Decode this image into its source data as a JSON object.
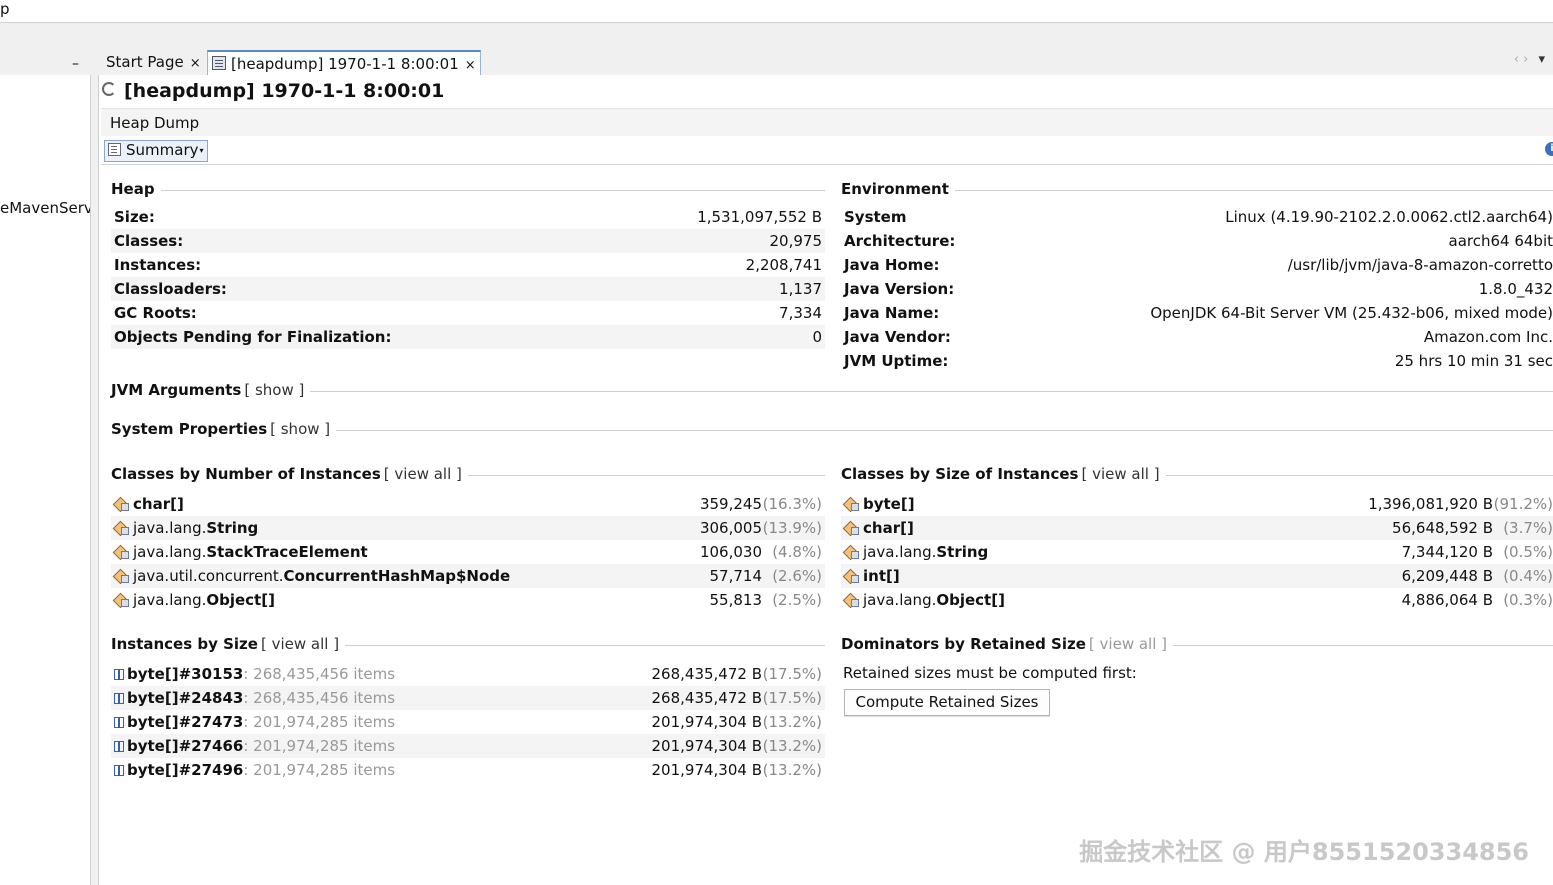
{
  "window": {
    "menu_fragment": "p"
  },
  "left_panel": {
    "text": "eMavenServ",
    "minimize": "–"
  },
  "tabs": [
    {
      "label": "Start Page",
      "close": "×"
    },
    {
      "label": "[heapdump] 1970-1-1 8:00:01",
      "close": "×"
    }
  ],
  "tab_nav": {
    "prev": "‹",
    "next": "›",
    "menu": "▾"
  },
  "doc": {
    "title": "[heapdump] 1970-1-1 8:00:01",
    "subtitle": "Heap Dump",
    "view_select": "Summary",
    "info": "i"
  },
  "heap": {
    "title": "Heap",
    "rows": [
      {
        "key": "Size:",
        "value": "1,531,097,552 B"
      },
      {
        "key": "Classes:",
        "value": "20,975"
      },
      {
        "key": "Instances:",
        "value": "2,208,741"
      },
      {
        "key": "Classloaders:",
        "value": "1,137"
      },
      {
        "key": "GC Roots:",
        "value": "7,334"
      },
      {
        "key": "Objects Pending for Finalization:",
        "value": "0"
      }
    ]
  },
  "environment": {
    "title": "Environment",
    "rows": [
      {
        "key": "System",
        "value": "Linux (4.19.90-2102.2.0.0062.ctl2.aarch64)"
      },
      {
        "key": "Architecture:",
        "value": "aarch64 64bit"
      },
      {
        "key": "Java Home:",
        "value": "/usr/lib/jvm/java-8-amazon-corretto"
      },
      {
        "key": "Java Version:",
        "value": "1.8.0_432"
      },
      {
        "key": "Java Name:",
        "value": "OpenJDK 64-Bit Server VM (25.432-b06, mixed mode)"
      },
      {
        "key": "Java Vendor:",
        "value": "Amazon.com Inc."
      },
      {
        "key": "JVM Uptime:",
        "value": "25 hrs 10 min 31 sec"
      }
    ]
  },
  "jvm_args": {
    "title": "JVM Arguments",
    "link": "[ show ]"
  },
  "sys_props": {
    "title": "System Properties",
    "link": "[ show ]"
  },
  "by_number": {
    "title": "Classes by Number of Instances",
    "link": "[ view all ]",
    "rows": [
      {
        "pkg": "",
        "name": "char[]",
        "count": "359,245",
        "pct": "(16.3%)"
      },
      {
        "pkg": "java.lang.",
        "name": "String",
        "count": "306,005",
        "pct": "(13.9%)"
      },
      {
        "pkg": "java.lang.",
        "name": "StackTraceElement",
        "count": "106,030",
        "pct": "(4.8%)"
      },
      {
        "pkg": "java.util.concurrent.",
        "name": "ConcurrentHashMap$Node",
        "count": "57,714",
        "pct": "(2.6%)"
      },
      {
        "pkg": "java.lang.",
        "name": "Object[]",
        "count": "55,813",
        "pct": "(2.5%)"
      }
    ]
  },
  "by_size": {
    "title": "Classes by Size of Instances",
    "link": "[ view all ]",
    "rows": [
      {
        "pkg": "",
        "name": "byte[]",
        "size": "1,396,081,920 B",
        "pct": "(91.2%)"
      },
      {
        "pkg": "",
        "name": "char[]",
        "size": "56,648,592 B",
        "pct": "(3.7%)"
      },
      {
        "pkg": "java.lang.",
        "name": "String",
        "size": "7,344,120 B",
        "pct": "(0.5%)"
      },
      {
        "pkg": "",
        "name": "int[]",
        "size": "6,209,448 B",
        "pct": "(0.4%)"
      },
      {
        "pkg": "java.lang.",
        "name": "Object[]",
        "size": "4,886,064 B",
        "pct": "(0.3%)"
      }
    ]
  },
  "instances_by_size": {
    "title": "Instances by Size",
    "link": "[ view all ]",
    "rows": [
      {
        "name": "byte[]#30153",
        "items": ": 268,435,456 items",
        "size": "268,435,472 B",
        "pct": "(17.5%)"
      },
      {
        "name": "byte[]#24843",
        "items": ": 268,435,456 items",
        "size": "268,435,472 B",
        "pct": "(17.5%)"
      },
      {
        "name": "byte[]#27473",
        "items": ": 201,974,285 items",
        "size": "201,974,304 B",
        "pct": "(13.2%)"
      },
      {
        "name": "byte[]#27466",
        "items": ": 201,974,285 items",
        "size": "201,974,304 B",
        "pct": "(13.2%)"
      },
      {
        "name": "byte[]#27496",
        "items": ": 201,974,285 items",
        "size": "201,974,304 B",
        "pct": "(13.2%)"
      }
    ]
  },
  "dominators": {
    "title": "Dominators by Retained Size",
    "link": "[ view all ]",
    "note": "Retained sizes must be computed first:",
    "button": "Compute Retained Sizes"
  },
  "watermark": "掘金技术社区 @ 用户8551520334856"
}
